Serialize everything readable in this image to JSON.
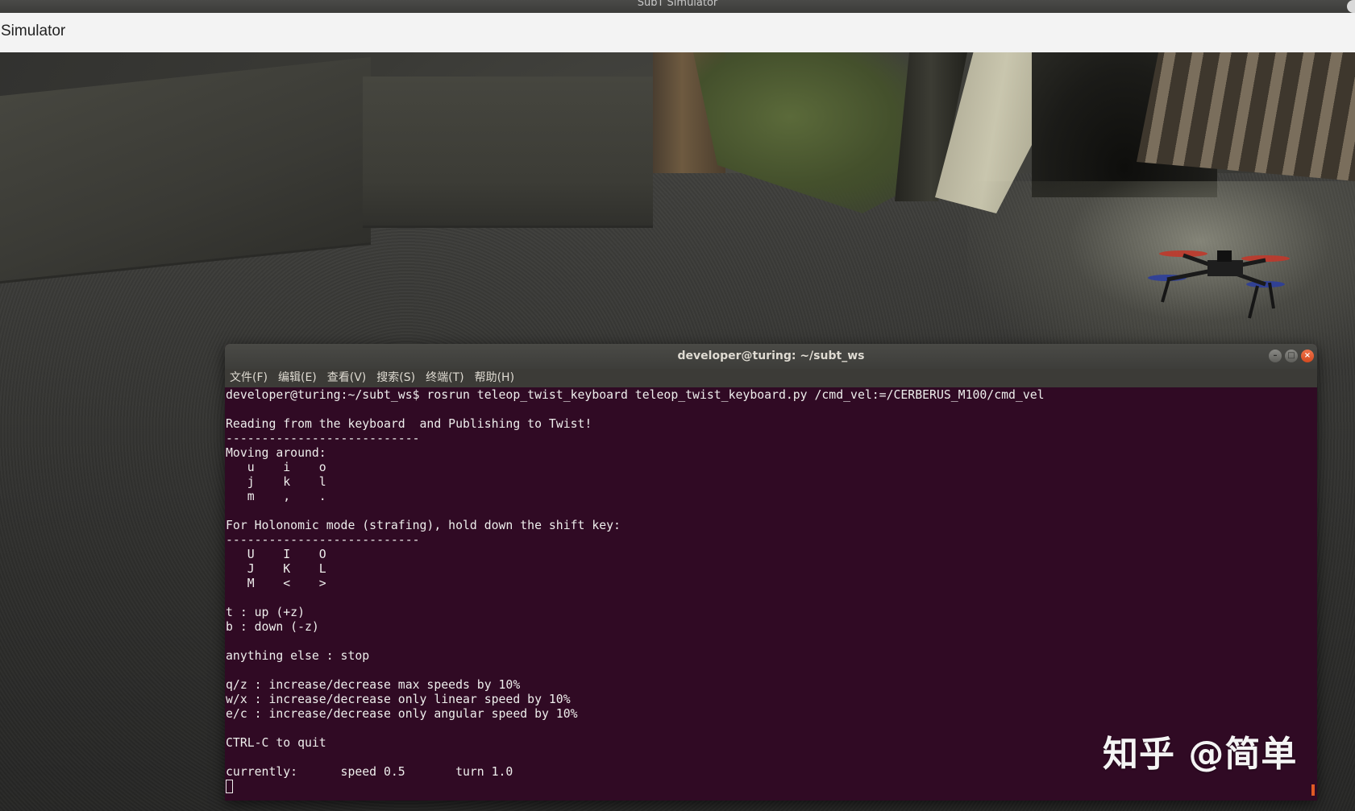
{
  "os_window": {
    "title": "SubT Simulator"
  },
  "app": {
    "header_label": "Simulator"
  },
  "terminal": {
    "title": "developer@turing: ~/subt_ws",
    "window_buttons": {
      "minimize": "–",
      "maximize": "□",
      "close": "×"
    },
    "menu": [
      "文件(F)",
      "编辑(E)",
      "查看(V)",
      "搜索(S)",
      "终端(T)",
      "帮助(H)"
    ],
    "lines": [
      "developer@turing:~/subt_ws$ rosrun teleop_twist_keyboard teleop_twist_keyboard.py /cmd_vel:=/CERBERUS_M100/cmd_vel",
      "",
      "Reading from the keyboard  and Publishing to Twist!",
      "---------------------------",
      "Moving around:",
      "   u    i    o",
      "   j    k    l",
      "   m    ,    .",
      "",
      "For Holonomic mode (strafing), hold down the shift key:",
      "---------------------------",
      "   U    I    O",
      "   J    K    L",
      "   M    <    >",
      "",
      "t : up (+z)",
      "b : down (-z)",
      "",
      "anything else : stop",
      "",
      "q/z : increase/decrease max speeds by 10%",
      "w/x : increase/decrease only linear speed by 10%",
      "e/c : increase/decrease only angular speed by 10%",
      "",
      "CTRL-C to quit",
      "",
      "currently:      speed 0.5       turn 1.0"
    ]
  },
  "watermark": "知乎 @简单",
  "colors": {
    "terminal_bg": "#300a24",
    "terminal_fg": "#eeeeec",
    "close_button": "#e0541f"
  }
}
